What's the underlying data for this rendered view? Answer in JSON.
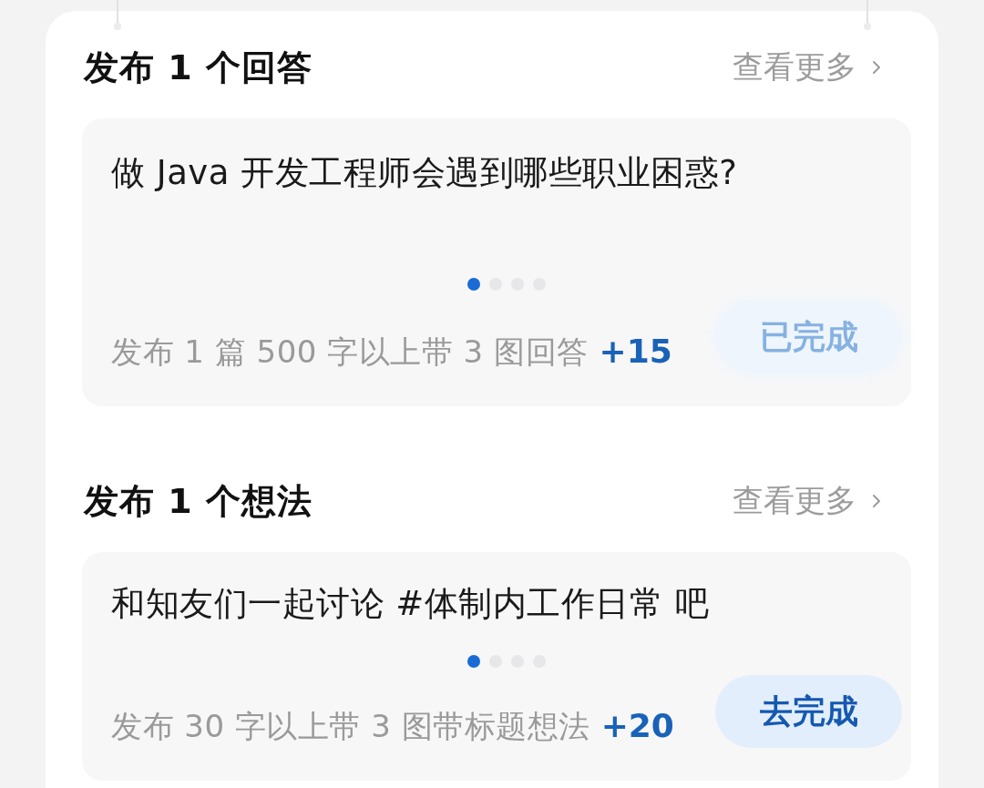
{
  "sections": [
    {
      "kind": "answer",
      "title": "发布 1 个回答",
      "more_link": "查看更多",
      "card": {
        "headline": "做 Java 开发工程师会遇到哪些职业困惑?",
        "pages": [
          {
            "selected": true
          },
          {
            "selected": false
          },
          {
            "selected": false
          },
          {
            "selected": false
          }
        ],
        "task": "发布 1 篇 500 字以上带 3 图回答",
        "reward": "+15",
        "button": {
          "label": "已完成",
          "completed": true
        }
      }
    },
    {
      "kind": "idea",
      "title": "发布 1 个想法",
      "more_link": "查看更多",
      "card": {
        "headline": "和知友们一起讨论 #体制内工作日常 吧",
        "pages": [
          {
            "selected": true
          },
          {
            "selected": false
          },
          {
            "selected": false
          },
          {
            "selected": false
          }
        ],
        "task": "发布 30 字以上带 3 图带标题想法",
        "reward": "+20",
        "button": {
          "label": "去完成",
          "completed": false
        }
      }
    }
  ]
}
